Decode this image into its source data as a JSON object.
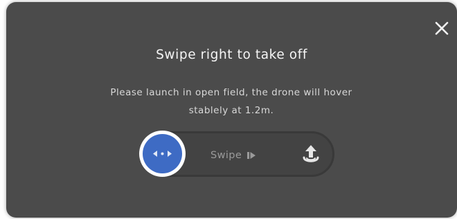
{
  "dialog": {
    "title": "Swipe right to take off",
    "message_line1": "Please launch in open field, the drone will hover",
    "message_line2": "stablely at 1.2m.",
    "close_icon": "close-icon",
    "slider": {
      "hint_label": "Swipe",
      "hint_icon": "play-arrow-icon",
      "knob_icon": "swipe-arrows-icon",
      "end_icon": "takeoff-icon",
      "progress": 0
    }
  },
  "colors": {
    "dialog_bg": "#4b4b4b",
    "knob_accent": "#3e6bc4",
    "knob_ring": "#ffffff",
    "track_bg": "#434343",
    "hint_text": "#9a9a9a"
  }
}
